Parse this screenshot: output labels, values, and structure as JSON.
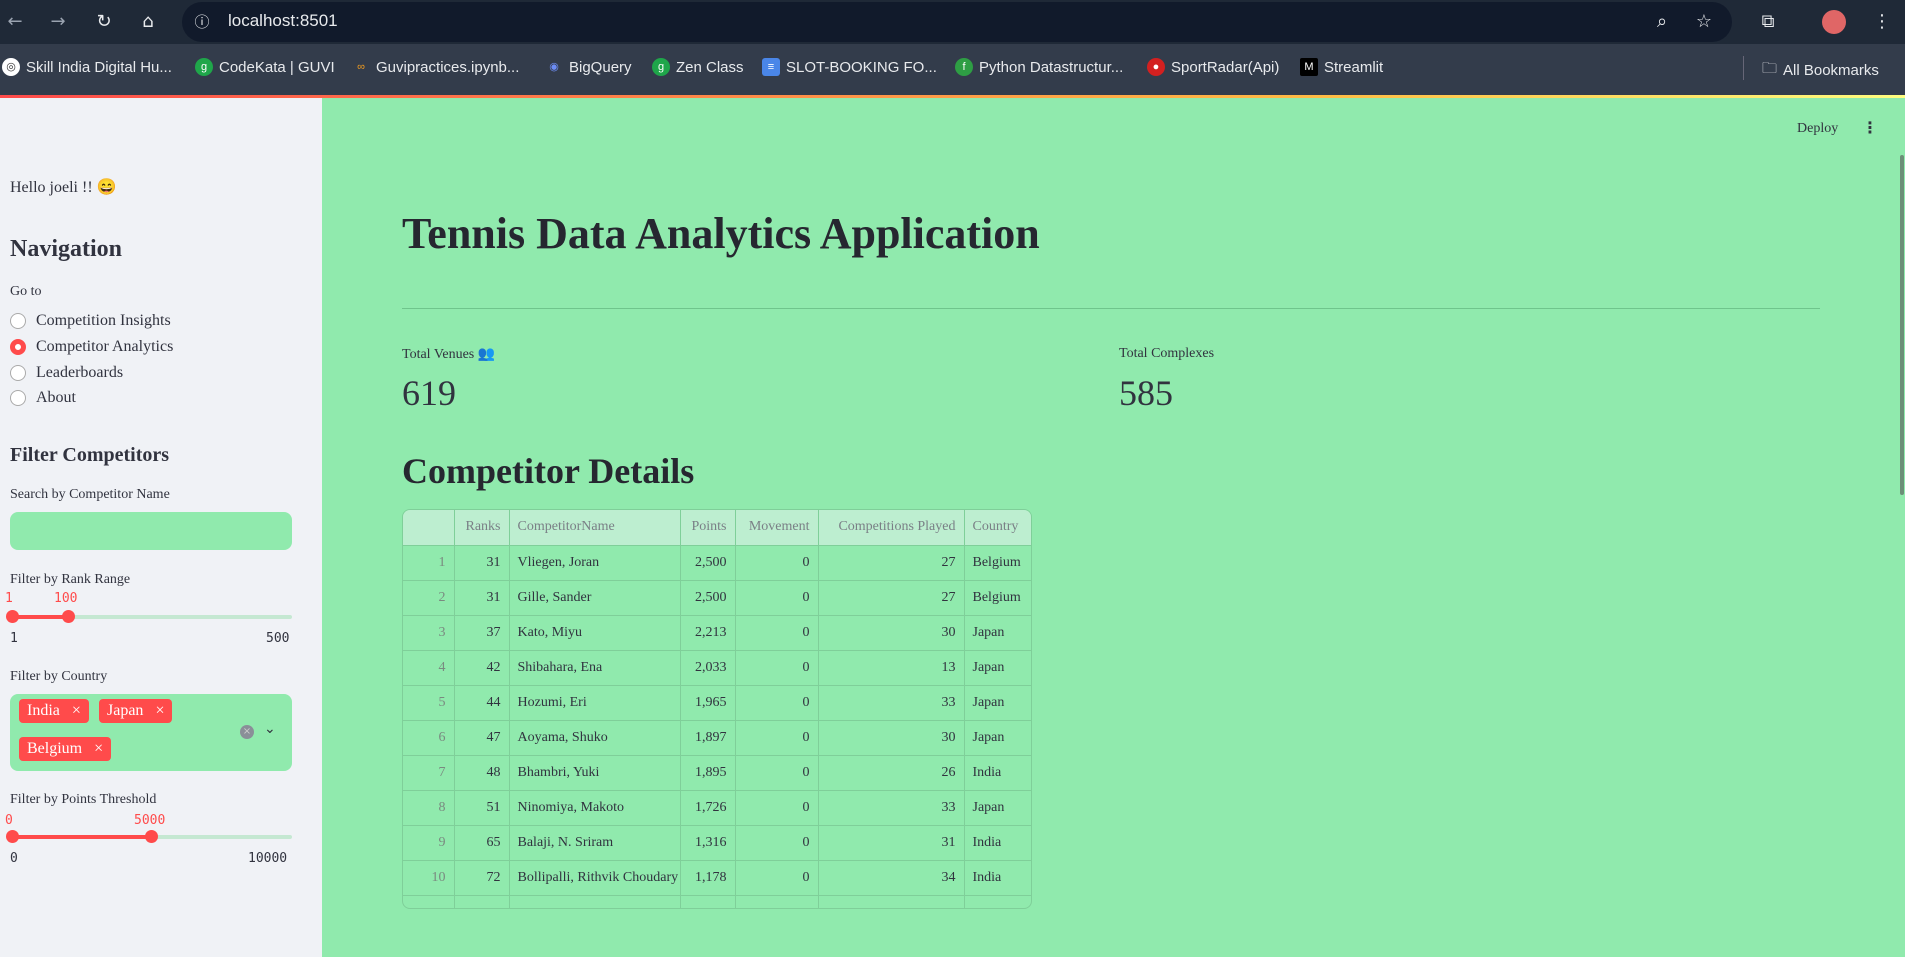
{
  "browser": {
    "url": "localhost:8501",
    "bookmarks": [
      "Skill India Digital Hu...",
      "CodeKata | GUVI",
      "Guvipractices.ipynb...",
      "BigQuery",
      "Zen Class",
      "SLOT-BOOKING FO...",
      "Python Datastructur...",
      "SportRadar(Api)",
      "Streamlit"
    ],
    "all_bookmarks": "All Bookmarks"
  },
  "header": {
    "deploy": "Deploy"
  },
  "sidebar": {
    "greeting": "Hello joeli !! 😄",
    "nav_title": "Navigation",
    "goto_label": "Go to",
    "nav_options": [
      "Competition Insights",
      "Competitor Analytics",
      "Leaderboards",
      "About"
    ],
    "selected": "Competitor Analytics",
    "filter_title": "Filter Competitors",
    "search_label": "Search by Competitor Name",
    "search_value": "",
    "rank_label": "Filter by Rank Range",
    "rank_low": "1",
    "rank_high": "100",
    "rank_min": "1",
    "rank_max": "500",
    "country_label": "Filter by Country",
    "countries": [
      "India",
      "Japan",
      "Belgium"
    ],
    "points_label": "Filter by Points Threshold",
    "points_low": "0",
    "points_high": "5000",
    "points_min": "0",
    "points_max": "10000"
  },
  "main": {
    "title": "Tennis Data Analytics Application",
    "metrics": [
      {
        "label": "Total Venues 👥",
        "value": "619"
      },
      {
        "label": "Total Complexes",
        "value": "585"
      }
    ],
    "section_title": "Competitor Details",
    "table": {
      "columns": [
        "",
        "Ranks",
        "CompetitorName",
        "Points",
        "Movement",
        "Competitions Played",
        "Country"
      ],
      "rows": [
        [
          "1",
          "31",
          "Vliegen, Joran",
          "2,500",
          "0",
          "27",
          "Belgium"
        ],
        [
          "2",
          "31",
          "Gille, Sander",
          "2,500",
          "0",
          "27",
          "Belgium"
        ],
        [
          "3",
          "37",
          "Kato, Miyu",
          "2,213",
          "0",
          "30",
          "Japan"
        ],
        [
          "4",
          "42",
          "Shibahara, Ena",
          "2,033",
          "0",
          "13",
          "Japan"
        ],
        [
          "5",
          "44",
          "Hozumi, Eri",
          "1,965",
          "0",
          "33",
          "Japan"
        ],
        [
          "6",
          "47",
          "Aoyama, Shuko",
          "1,897",
          "0",
          "30",
          "Japan"
        ],
        [
          "7",
          "48",
          "Bhambri, Yuki",
          "1,895",
          "0",
          "26",
          "India"
        ],
        [
          "8",
          "51",
          "Ninomiya, Makoto",
          "1,726",
          "0",
          "33",
          "Japan"
        ],
        [
          "9",
          "65",
          "Balaji, N. Sriram",
          "1,316",
          "0",
          "31",
          "India"
        ],
        [
          "10",
          "72",
          "Bollipalli, Rithvik Choudary",
          "1,178",
          "0",
          "34",
          "India"
        ]
      ]
    }
  },
  "colors": {
    "accent": "#ff4b4b",
    "main_bg": "#90eaad",
    "sidebar_bg": "#f0f2f6"
  }
}
